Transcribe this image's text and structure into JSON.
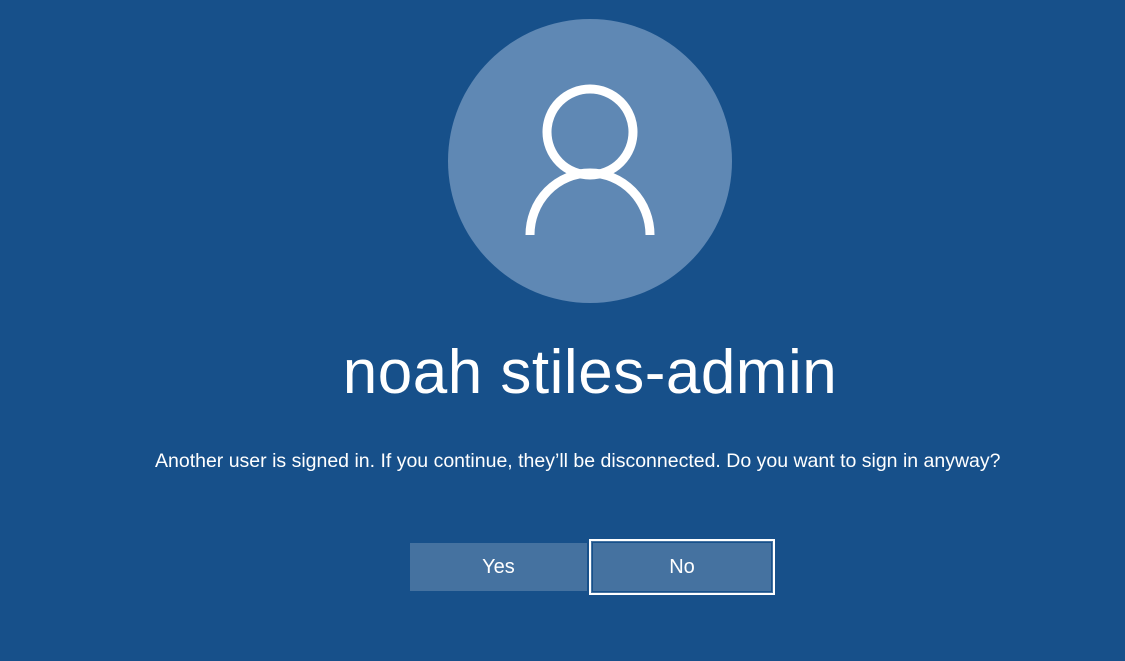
{
  "user": {
    "avatar_icon": "user-silhouette-icon",
    "name": "noah stiles-admin"
  },
  "prompt": {
    "message": "Another user is signed in. If you continue, they’ll be disconnected. Do you want to sign in anyway?"
  },
  "buttons": {
    "yes_label": "Yes",
    "no_label": "No"
  },
  "colors": {
    "background": "#17508a",
    "avatar_circle": "#5f88b4",
    "button": "#4572a0",
    "text": "#ffffff",
    "focus_border": "#ffffff"
  }
}
